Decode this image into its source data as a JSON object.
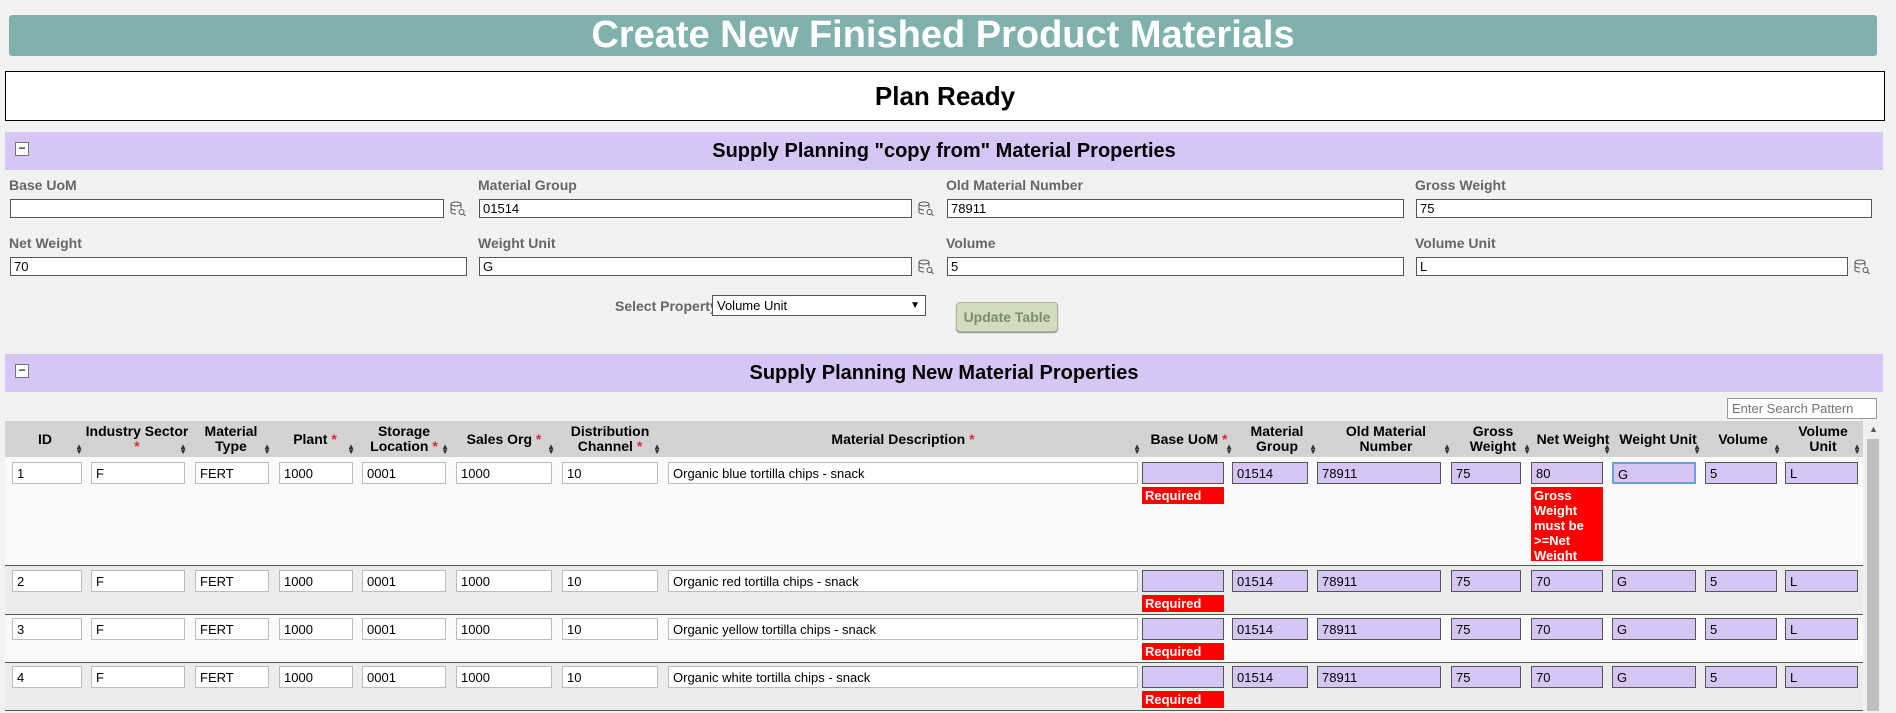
{
  "page_title": "Create New Finished Product Materials",
  "status": "Plan Ready",
  "copy_section": {
    "title": "Supply Planning \"copy from\" Material Properties",
    "collapse": "−",
    "fields": [
      {
        "label": "Base UoM",
        "value": ""
      },
      {
        "label": "Material Group",
        "value": "01514"
      },
      {
        "label": "Old Material Number",
        "value": "78911"
      },
      {
        "label": "Gross Weight",
        "value": "75"
      },
      {
        "label": "Net Weight",
        "value": "70"
      },
      {
        "label": "Weight Unit",
        "value": "G"
      },
      {
        "label": "Volume",
        "value": "5"
      },
      {
        "label": "Volume Unit",
        "value": "L"
      }
    ],
    "select_property_label": "Select Property",
    "select_property_value": "Volume Unit",
    "update_button": "Update Table"
  },
  "new_section": {
    "title": "Supply Planning New Material Properties",
    "collapse": "−",
    "search_placeholder": "Enter Search Pattern",
    "columns": [
      {
        "label": "ID",
        "required": false
      },
      {
        "label": "Industry Sector",
        "required": true
      },
      {
        "label": "Material Type",
        "required": false
      },
      {
        "label": "Plant",
        "required": true
      },
      {
        "label": "Storage Location",
        "required": true
      },
      {
        "label": "Sales Org",
        "required": true
      },
      {
        "label": "Distribution Channel",
        "required": true
      },
      {
        "label": "Material Description",
        "required": true
      },
      {
        "label": "Base UoM",
        "required": true
      },
      {
        "label": "Material Group",
        "required": false
      },
      {
        "label": "Old Material Number",
        "required": false
      },
      {
        "label": "Gross Weight",
        "required": false
      },
      {
        "label": "Net Weight",
        "required": false
      },
      {
        "label": "Weight Unit",
        "required": false
      },
      {
        "label": "Volume",
        "required": false
      },
      {
        "label": "Volume Unit",
        "required": false
      }
    ],
    "rows": [
      {
        "id": "1",
        "industry": "F",
        "type": "FERT",
        "plant": "1000",
        "storage": "0001",
        "sales_org": "1000",
        "dist": "10",
        "desc": "Organic blue tortilla chips - snack",
        "base_uom": "",
        "group": "01514",
        "old_num": "78911",
        "gross": "75",
        "net": "80",
        "weight_unit": "G",
        "volume": "5",
        "volume_unit": "L",
        "base_error": "Required",
        "net_error": "Gross Weight must be >=Net Weight"
      },
      {
        "id": "2",
        "industry": "F",
        "type": "FERT",
        "plant": "1000",
        "storage": "0001",
        "sales_org": "1000",
        "dist": "10",
        "desc": "Organic red tortilla chips - snack",
        "base_uom": "",
        "group": "01514",
        "old_num": "78911",
        "gross": "75",
        "net": "70",
        "weight_unit": "G",
        "volume": "5",
        "volume_unit": "L",
        "base_error": "Required",
        "net_error": ""
      },
      {
        "id": "3",
        "industry": "F",
        "type": "FERT",
        "plant": "1000",
        "storage": "0001",
        "sales_org": "1000",
        "dist": "10",
        "desc": "Organic yellow tortilla chips - snack",
        "base_uom": "",
        "group": "01514",
        "old_num": "78911",
        "gross": "75",
        "net": "70",
        "weight_unit": "G",
        "volume": "5",
        "volume_unit": "L",
        "base_error": "Required",
        "net_error": ""
      },
      {
        "id": "4",
        "industry": "F",
        "type": "FERT",
        "plant": "1000",
        "storage": "0001",
        "sales_org": "1000",
        "dist": "10",
        "desc": "Organic white tortilla chips - snack",
        "base_uom": "",
        "group": "01514",
        "old_num": "78911",
        "gross": "75",
        "net": "70",
        "weight_unit": "G",
        "volume": "5",
        "volume_unit": "L",
        "base_error": "Required",
        "net_error": ""
      }
    ]
  },
  "colors": {
    "title_bg": "#80b1ad",
    "section_bg": "#d6c6f5",
    "error": "#ff0000",
    "required_star": "#e0283c"
  }
}
